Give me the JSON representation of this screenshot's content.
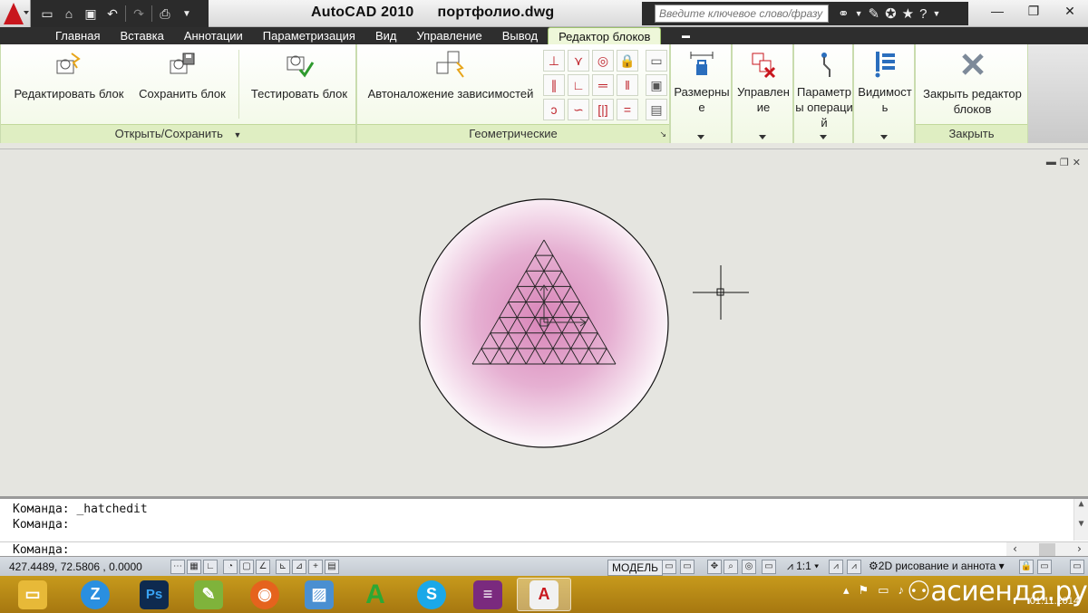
{
  "titlebar": {
    "app_name": "AutoCAD 2010",
    "file_name": "портфолио.dwg",
    "search_placeholder": "Введите ключевое слово/фразу"
  },
  "qat_icons": [
    "new-icon",
    "open-icon",
    "save-icon",
    "undo-icon",
    "redo-icon",
    "plot-icon"
  ],
  "tabs": [
    {
      "label": "Главная"
    },
    {
      "label": "Вставка"
    },
    {
      "label": "Аннотации"
    },
    {
      "label": "Параметризация"
    },
    {
      "label": "Вид"
    },
    {
      "label": "Управление"
    },
    {
      "label": "Вывод"
    },
    {
      "label": "Редактор блоков",
      "active": true
    }
  ],
  "ribbon": {
    "panel_open_save": {
      "title": "Открыть/Сохранить",
      "edit_block": "Редактировать блок",
      "save_block": "Сохранить блок",
      "test_block": "Тестировать блок"
    },
    "panel_geometric": {
      "title": "Геометрические",
      "auto_constrain": "Автоналожение зависимостей"
    },
    "dimensional": "Размерные",
    "management": "Управление",
    "action_params": "Параметры операций",
    "visibility": "Видимость",
    "panel_close": {
      "title": "Закрыть",
      "close_editor": "Закрыть редактор блоков"
    }
  },
  "command_line": {
    "history": [
      "Команда:  _hatchedit",
      "Команда:"
    ],
    "prompt": "Команда:"
  },
  "status": {
    "coords": "427.4489,  72.5806 , 0.0000",
    "model": "МОДЕЛЬ",
    "scale": "1:1",
    "workspace": "2D рисование и аннота"
  },
  "taskbar": {
    "apps": [
      "explorer-icon",
      "zoho-icon",
      "photoshop-icon",
      "notepad-icon",
      "firefox-icon",
      "photo-viewer-icon",
      "archicad-icon",
      "skype-icon",
      "winrar-icon",
      "autocad-icon"
    ],
    "date": "01.11.2014"
  },
  "watermark": "асиенда.ру",
  "colors": {
    "accent_ribbon": "#dfeec2",
    "autocad_red": "#c8161d",
    "hatch_pink": "#d884b8",
    "taskbar": "#b8861a"
  }
}
